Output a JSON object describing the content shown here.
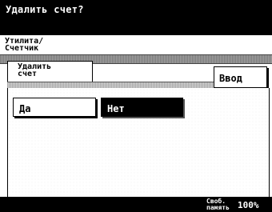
{
  "title": "Удалить счет?",
  "breadcrumb": {
    "line1": "Утилита/",
    "line2": "Счетчик"
  },
  "tab": {
    "line1": "Удалить",
    "line2": "счет"
  },
  "enter_button": "Ввод",
  "yes_button": "Да",
  "no_button": "Нет",
  "memory": {
    "label_line1": "Своб.",
    "label_line2": "память",
    "value": "100%"
  },
  "colors": {
    "background": "#ffffff",
    "bar": "#000000",
    "selected": "#000000"
  }
}
